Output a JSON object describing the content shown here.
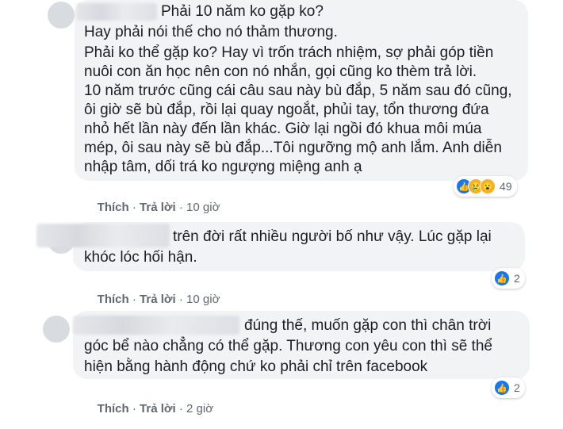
{
  "comments": [
    {
      "lines": [
        "Phải 10 năm ko gặp ko?",
        "Hay phải nói thế cho nó thảm thương.",
        "Phải ko thể gặp ko? Hay vì trốn trách nhiệm, sợ phải góp tiền",
        "nuôi con ăn học nên con nó nhắn, gọi cũng ko thèm trả lời.",
        "10 năm trước cũng cái câu sau này bù đắp, 5 năm sau đó cũng,",
        "ôi giờ sẽ bù đắp, rồi lại quay ngoắt, phủi tay, tổn thương đứa",
        "nhỏ hết lần này đến lần khác. Giờ lại ngồi đó khua môi múa",
        "mép, ôi sau này sẽ bù đắp...Tôi ngưỡng mộ anh lắm. Anh diễn",
        "nhập tâm, dối trá ko ngượng miệng anh ạ"
      ],
      "like": "Thích",
      "reply": "Trả lời",
      "time": "10 giờ",
      "reactions": [
        "like-icon",
        "sad-icon",
        "wow-icon"
      ],
      "reaction_count": "49"
    },
    {
      "lines": [
        "trên đời rất nhiều người bố như vậy. Lúc gặp lại",
        "khóc lóc hối hận."
      ],
      "like": "Thích",
      "reply": "Trả lời",
      "time": "10 giờ",
      "reactions": [
        "like-icon"
      ],
      "reaction_count": "2"
    },
    {
      "lines": [
        "đúng thế, muốn gặp con thì chân trời",
        "góc bể nào chẳng có thể gặp. Thương con yêu con thì sẽ thể",
        "hiện bằng hành động chứ ko phải chỉ trên facebook"
      ],
      "like": "Thích",
      "reply": "Trả lời",
      "time": "2 giờ",
      "reactions": [
        "like-icon"
      ],
      "reaction_count": "2"
    }
  ],
  "separator": " · ",
  "colors": {
    "bubble": "#f2f3f5",
    "text": "#1c1e21",
    "meta": "#606770",
    "like": "#1877f2",
    "emoji": "#f7b125"
  }
}
